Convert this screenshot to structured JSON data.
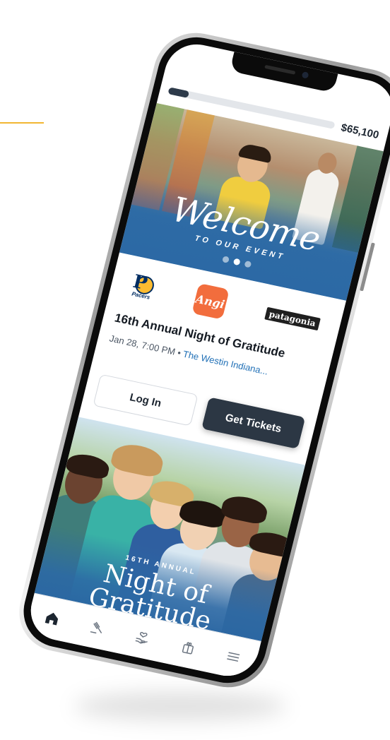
{
  "progress": {
    "amount": "$65,100",
    "fraction": 0.12
  },
  "banner": {
    "title": "Welcome",
    "subtitle": "TO OUR EVENT",
    "slides": 3,
    "active_slide": 1
  },
  "sponsors": [
    {
      "name": "Pacers",
      "icon": "pacers-logo"
    },
    {
      "name": "Angi",
      "icon": "angi-logo"
    },
    {
      "name": "patagonia",
      "icon": "patagonia-logo"
    }
  ],
  "event": {
    "title": "16th Annual Night of Gratitude",
    "datetime": "Jan 28, 7:00 PM",
    "separator": "•",
    "venue": "The Westin Indiana..."
  },
  "buttons": {
    "login": "Log In",
    "tickets": "Get Tickets"
  },
  "hero": {
    "subtitle": "16TH ANNUAL",
    "title": "Night of Gratitude"
  },
  "nav": [
    {
      "icon": "home-icon",
      "active": true
    },
    {
      "icon": "gavel-icon",
      "active": false
    },
    {
      "icon": "donate-heart-icon",
      "active": false
    },
    {
      "icon": "gift-icon",
      "active": false
    },
    {
      "icon": "menu-icon",
      "active": false
    }
  ],
  "colors": {
    "accent": "#f2b632",
    "primary_dark": "#2c3744",
    "link": "#1f6fb6",
    "banner_blue": "#2c69a5"
  }
}
